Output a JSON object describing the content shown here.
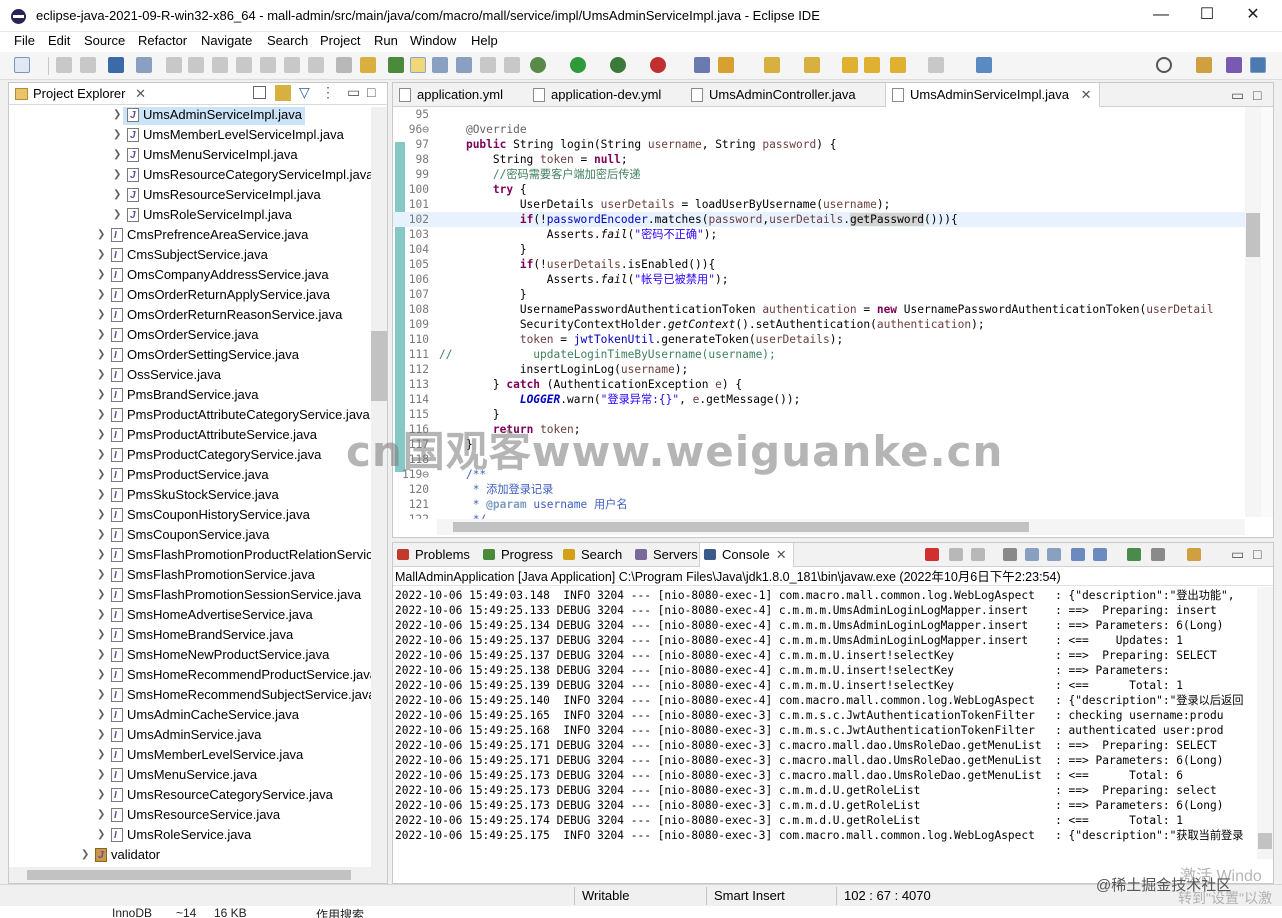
{
  "window": {
    "title": "eclipse-java-2021-09-R-win32-x86_64 - mall-admin/src/main/java/com/macro/mall/service/impl/UmsAdminServiceImpl.java - Eclipse IDE",
    "minimize": "—",
    "maximize": "☐",
    "close": "✕"
  },
  "menu": [
    "File",
    "Edit",
    "Source",
    "Refactor",
    "Navigate",
    "Search",
    "Project",
    "Run",
    "Window",
    "Help"
  ],
  "project_explorer": {
    "tab_label": "Project Explorer",
    "tab_close": "✕",
    "items": [
      {
        "label": "UmsAdminServiceImpl.java",
        "depth": 1,
        "kind": "class",
        "selected": true
      },
      {
        "label": "UmsMemberLevelServiceImpl.java",
        "depth": 1,
        "kind": "class"
      },
      {
        "label": "UmsMenuServiceImpl.java",
        "depth": 1,
        "kind": "class"
      },
      {
        "label": "UmsResourceCategoryServiceImpl.java",
        "depth": 1,
        "kind": "class"
      },
      {
        "label": "UmsResourceServiceImpl.java",
        "depth": 1,
        "kind": "class"
      },
      {
        "label": "UmsRoleServiceImpl.java",
        "depth": 1,
        "kind": "class"
      },
      {
        "label": "CmsPrefrenceAreaService.java",
        "depth": 0,
        "kind": "iface"
      },
      {
        "label": "CmsSubjectService.java",
        "depth": 0,
        "kind": "iface"
      },
      {
        "label": "OmsCompanyAddressService.java",
        "depth": 0,
        "kind": "iface"
      },
      {
        "label": "OmsOrderReturnApplyService.java",
        "depth": 0,
        "kind": "iface"
      },
      {
        "label": "OmsOrderReturnReasonService.java",
        "depth": 0,
        "kind": "iface"
      },
      {
        "label": "OmsOrderService.java",
        "depth": 0,
        "kind": "iface"
      },
      {
        "label": "OmsOrderSettingService.java",
        "depth": 0,
        "kind": "iface"
      },
      {
        "label": "OssService.java",
        "depth": 0,
        "kind": "iface"
      },
      {
        "label": "PmsBrandService.java",
        "depth": 0,
        "kind": "iface"
      },
      {
        "label": "PmsProductAttributeCategoryService.java",
        "depth": 0,
        "kind": "iface"
      },
      {
        "label": "PmsProductAttributeService.java",
        "depth": 0,
        "kind": "iface"
      },
      {
        "label": "PmsProductCategoryService.java",
        "depth": 0,
        "kind": "iface"
      },
      {
        "label": "PmsProductService.java",
        "depth": 0,
        "kind": "iface"
      },
      {
        "label": "PmsSkuStockService.java",
        "depth": 0,
        "kind": "iface"
      },
      {
        "label": "SmsCouponHistoryService.java",
        "depth": 0,
        "kind": "iface"
      },
      {
        "label": "SmsCouponService.java",
        "depth": 0,
        "kind": "iface"
      },
      {
        "label": "SmsFlashPromotionProductRelationService.java",
        "depth": 0,
        "kind": "iface"
      },
      {
        "label": "SmsFlashPromotionService.java",
        "depth": 0,
        "kind": "iface"
      },
      {
        "label": "SmsFlashPromotionSessionService.java",
        "depth": 0,
        "kind": "iface"
      },
      {
        "label": "SmsHomeAdvertiseService.java",
        "depth": 0,
        "kind": "iface"
      },
      {
        "label": "SmsHomeBrandService.java",
        "depth": 0,
        "kind": "iface"
      },
      {
        "label": "SmsHomeNewProductService.java",
        "depth": 0,
        "kind": "iface"
      },
      {
        "label": "SmsHomeRecommendProductService.java",
        "depth": 0,
        "kind": "iface"
      },
      {
        "label": "SmsHomeRecommendSubjectService.java",
        "depth": 0,
        "kind": "iface"
      },
      {
        "label": "UmsAdminCacheService.java",
        "depth": 0,
        "kind": "iface"
      },
      {
        "label": "UmsAdminService.java",
        "depth": 0,
        "kind": "iface"
      },
      {
        "label": "UmsMemberLevelService.java",
        "depth": 0,
        "kind": "iface"
      },
      {
        "label": "UmsMenuService.java",
        "depth": 0,
        "kind": "iface"
      },
      {
        "label": "UmsResourceCategoryService.java",
        "depth": 0,
        "kind": "iface"
      },
      {
        "label": "UmsResourceService.java",
        "depth": 0,
        "kind": "iface"
      },
      {
        "label": "UmsRoleService.java",
        "depth": 0,
        "kind": "iface"
      },
      {
        "label": "validator",
        "depth": -1,
        "kind": "package"
      }
    ]
  },
  "editor": {
    "tabs": [
      {
        "label": "application.yml",
        "active": false
      },
      {
        "label": "application-dev.yml",
        "active": false
      },
      {
        "label": "UmsAdminController.java",
        "active": false
      },
      {
        "label": "UmsAdminServiceImpl.java",
        "active": true,
        "close": "✕"
      }
    ],
    "lines": [
      {
        "n": "95",
        "html": ""
      },
      {
        "n": "96⊖",
        "html": "    <span class='an'>@Override</span>"
      },
      {
        "n": "97",
        "html": "    <span class='kw'>public</span> String login(String <span class='fd' style='color:#6a3e3e'>username</span>, String <span style='color:#6a3e3e'>password</span>) {"
      },
      {
        "n": "98",
        "html": "        String <span style='color:#6a3e3e'>token</span> = <span class='kw'>null</span>;"
      },
      {
        "n": "99",
        "html": "        <span class='cm'>//密码需要客户端加密后传递</span>"
      },
      {
        "n": "100",
        "html": "        <span class='kw'>try</span> {"
      },
      {
        "n": "101",
        "html": "            UserDetails <span style='color:#6a3e3e'>userDetails</span> = loadUserByUsername(<span style='color:#6a3e3e'>username</span>);"
      },
      {
        "n": "102",
        "html": "            <span class='kw'>if</span>(!<span class='fd'>passwordEncoder</span>.matches(<span style='color:#6a3e3e'>password</span>,<span style='color:#6a3e3e'>userDetails</span>.<span style='background:#d4d4d4'>getPassword</span>())){",
        "hl": true
      },
      {
        "n": "103",
        "html": "                Asserts.<span class='it'>fail</span>(<span class='st'>\"密码不正确\"</span>);"
      },
      {
        "n": "104",
        "html": "            }"
      },
      {
        "n": "105",
        "html": "            <span class='kw'>if</span>(!<span style='color:#6a3e3e'>userDetails</span>.isEnabled()){"
      },
      {
        "n": "106",
        "html": "                Asserts.<span class='it'>fail</span>(<span class='st'>\"帐号已被禁用\"</span>);"
      },
      {
        "n": "107",
        "html": "            }"
      },
      {
        "n": "108",
        "html": "            UsernamePasswordAuthenticationToken <span style='color:#6a3e3e'>authentication</span> = <span class='kw'>new</span> UsernamePasswordAuthenticationToken(<span style='color:#6a3e3e'>userDetail</span>"
      },
      {
        "n": "109",
        "html": "            SecurityContextHolder.<span class='it'>getContext</span>().setAuthentication(<span style='color:#6a3e3e'>authentication</span>);"
      },
      {
        "n": "110",
        "html": "            <span style='color:#6a3e3e'>token</span> = <span class='fd'>jwtTokenUtil</span>.generateToken(<span style='color:#6a3e3e'>userDetails</span>);"
      },
      {
        "n": "111",
        "html": "<span class='cm'>//            updateLoginTimeByUsername(username);</span>"
      },
      {
        "n": "112",
        "html": "            insertLoginLog(<span style='color:#6a3e3e'>username</span>);"
      },
      {
        "n": "113",
        "html": "        } <span class='kw'>catch</span> (AuthenticationException <span style='color:#6a3e3e'>e</span>) {"
      },
      {
        "n": "114",
        "html": "            <span class='fd it' style='font-weight:bold'>LOGGER</span>.warn(<span class='st'>\"登录异常:{}\"</span>, <span style='color:#6a3e3e'>e</span>.getMessage());"
      },
      {
        "n": "115",
        "html": "        }"
      },
      {
        "n": "116",
        "html": "        <span class='kw'>return</span> <span style='color:#6a3e3e'>token</span>;"
      },
      {
        "n": "117",
        "html": "    }"
      },
      {
        "n": "118",
        "html": ""
      },
      {
        "n": "119⊖",
        "html": "    <span class='jd'>/**</span>"
      },
      {
        "n": "120",
        "html": "     <span class='jd'>* 添加登录记录</span>"
      },
      {
        "n": "121",
        "html": "     <span class='jd'>* <b style='color:#7f9fbf'>@param</b> username 用户名</span>"
      },
      {
        "n": "122",
        "html": "     <span class='jd'>*/</span>"
      }
    ]
  },
  "console": {
    "tabs": [
      {
        "label": "Problems",
        "icon": "problems-icon",
        "color": "#c0392b"
      },
      {
        "label": "Progress",
        "icon": "progress-icon",
        "color": "#4a8a3a"
      },
      {
        "label": "Search",
        "icon": "search-icon",
        "color": "#d4a017"
      },
      {
        "label": "Servers",
        "icon": "servers-icon",
        "color": "#7a6a9a"
      },
      {
        "label": "Console",
        "icon": "console-icon",
        "color": "#3a5a8a",
        "active": true,
        "close": "✕"
      }
    ],
    "description": "MallAdminApplication [Java Application] C:\\Program Files\\Java\\jdk1.8.0_181\\bin\\javaw.exe  (2022年10月6日下午2:23:54)",
    "lines": [
      "2022-10-06 15:49:03.148  INFO 3204 --- [nio-8080-exec-1] com.macro.mall.common.log.WebLogAspect   : {\"description\":\"登出功能\",",
      "2022-10-06 15:49:25.133 DEBUG 3204 --- [nio-8080-exec-4] c.m.m.m.UmsAdminLoginLogMapper.insert    : ==>  Preparing: insert",
      "2022-10-06 15:49:25.134 DEBUG 3204 --- [nio-8080-exec-4] c.m.m.m.UmsAdminLoginLogMapper.insert    : ==> Parameters: 6(Long)",
      "2022-10-06 15:49:25.137 DEBUG 3204 --- [nio-8080-exec-4] c.m.m.m.UmsAdminLoginLogMapper.insert    : <==    Updates: 1",
      "2022-10-06 15:49:25.137 DEBUG 3204 --- [nio-8080-exec-4] c.m.m.m.U.insert!selectKey               : ==>  Preparing: SELECT",
      "2022-10-06 15:49:25.138 DEBUG 3204 --- [nio-8080-exec-4] c.m.m.m.U.insert!selectKey               : ==> Parameters: ",
      "2022-10-06 15:49:25.139 DEBUG 3204 --- [nio-8080-exec-4] c.m.m.m.U.insert!selectKey               : <==      Total: 1",
      "2022-10-06 15:49:25.140  INFO 3204 --- [nio-8080-exec-4] com.macro.mall.common.log.WebLogAspect   : {\"description\":\"登录以后返回",
      "2022-10-06 15:49:25.165  INFO 3204 --- [nio-8080-exec-3] c.m.m.s.c.JwtAuthenticationTokenFilter   : checking username:produ",
      "2022-10-06 15:49:25.168  INFO 3204 --- [nio-8080-exec-3] c.m.m.s.c.JwtAuthenticationTokenFilter   : authenticated user:prod",
      "2022-10-06 15:49:25.171 DEBUG 3204 --- [nio-8080-exec-3] c.macro.mall.dao.UmsRoleDao.getMenuList  : ==>  Preparing: SELECT",
      "2022-10-06 15:49:25.171 DEBUG 3204 --- [nio-8080-exec-3] c.macro.mall.dao.UmsRoleDao.getMenuList  : ==> Parameters: 6(Long)",
      "2022-10-06 15:49:25.173 DEBUG 3204 --- [nio-8080-exec-3] c.macro.mall.dao.UmsRoleDao.getMenuList  : <==      Total: 6",
      "2022-10-06 15:49:25.173 DEBUG 3204 --- [nio-8080-exec-3] c.m.m.d.U.getRoleList                    : ==>  Preparing: select",
      "2022-10-06 15:49:25.173 DEBUG 3204 --- [nio-8080-exec-3] c.m.m.d.U.getRoleList                    : ==> Parameters: 6(Long)",
      "2022-10-06 15:49:25.174 DEBUG 3204 --- [nio-8080-exec-3] c.m.m.d.U.getRoleList                    : <==      Total: 1",
      "2022-10-06 15:49:25.175  INFO 3204 --- [nio-8080-exec-3] com.macro.mall.common.log.WebLogAspect   : {\"description\":\"获取当前登录"
    ]
  },
  "status": {
    "mode": "Writable",
    "insert": "Smart Insert",
    "position": "102 : 67 : 4070"
  },
  "overlay": {
    "watermark": "cn国观客www.weiguanke.cn",
    "juejin": "@稀土掘金技术社区",
    "activate1": "激活 Windo",
    "activate2": "转到\"设置\"以激"
  },
  "desktop_strip": [
    "InnoDB",
    "~14",
    "16 KB",
    "作用搜索"
  ]
}
